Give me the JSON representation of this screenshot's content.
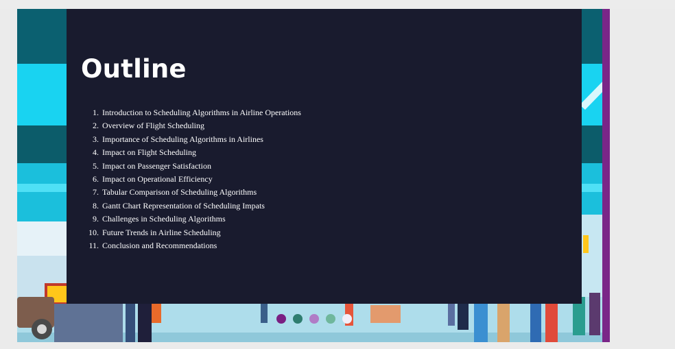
{
  "slide": {
    "title": "Outline",
    "items": [
      {
        "num": "1.",
        "text": "Introduction to Scheduling Algorithms in Airline Operations"
      },
      {
        "num": "2.",
        "text": "Overview of Flight Scheduling"
      },
      {
        "num": "3.",
        "text": "Importance of Scheduling Algorithms in Airlines"
      },
      {
        "num": "4.",
        "text": "Impact on Flight Scheduling"
      },
      {
        "num": "5.",
        "text": "Impact on Passenger Satisfaction"
      },
      {
        "num": "6.",
        "text": "Impact on Operational Efficiency"
      },
      {
        "num": "7.",
        "text": "Tabular Comparison of Scheduling Algorithms"
      },
      {
        "num": "8.",
        "text": "Gantt Chart Representation of Scheduling Impats"
      },
      {
        "num": "9.",
        "text": "Challenges in Scheduling Algorithms"
      },
      {
        "num": "10.",
        "text": "Future Trends in Airline Scheduling"
      },
      {
        "num": "11.",
        "text": "Conclusion and Recommendations"
      }
    ],
    "background": "airport terminal illustration",
    "accent_color": "#7a2688",
    "panel_color": "#191b2e"
  },
  "pagination": {
    "dots": [
      {
        "color": "#7a1f82",
        "active": false
      },
      {
        "color": "#2e7d6f",
        "active": false
      },
      {
        "color": "#b07cc6",
        "active": false
      },
      {
        "color": "#6fb79c",
        "active": false
      },
      {
        "color": "#f3eef8",
        "active": true
      }
    ]
  }
}
